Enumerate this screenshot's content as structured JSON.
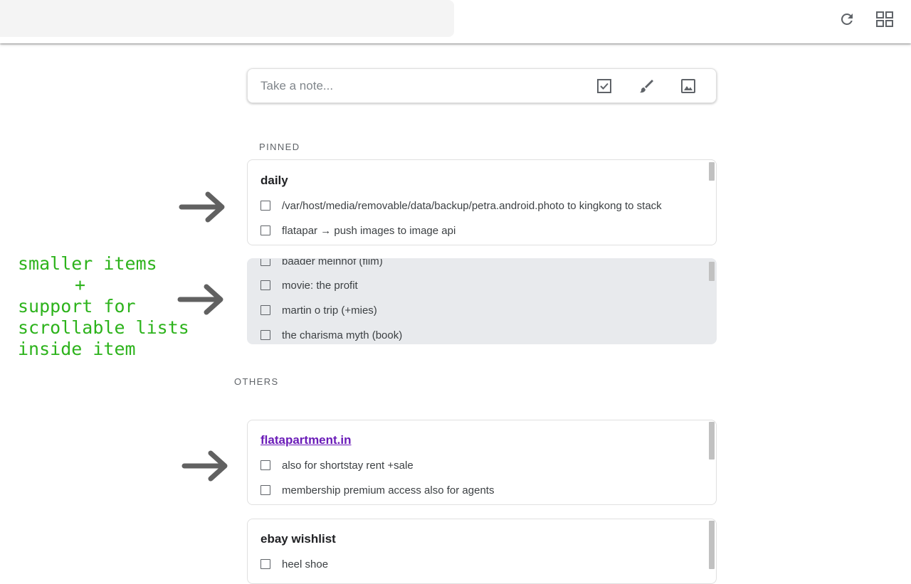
{
  "topbar": {
    "search_placeholder": "",
    "icons": [
      "refresh-icon",
      "grid-view-icon"
    ]
  },
  "take_note": {
    "placeholder": "Take a note...",
    "icons": [
      "checkbox-icon",
      "brush-icon",
      "image-icon"
    ]
  },
  "sections": {
    "pinned": "PINNED",
    "others": "OTHERS"
  },
  "cards": {
    "daily": {
      "title": "daily",
      "items": [
        "/var/host/media/removable/data/backup/petra.android.photo to kingkong to stack",
        "flatapar → push images to image api"
      ]
    },
    "scroll_list": {
      "items": [
        "baader meinhof (film)",
        "movie: the profit",
        "martin o trip (+mies)",
        "the charisma myth (book)"
      ]
    },
    "flatapartment": {
      "title": "flatapartment.in",
      "items": [
        "also for shortstay rent +sale",
        "membership premium access also for agents"
      ]
    },
    "ebay": {
      "title": "ebay wishlist",
      "items": [
        "heel shoe"
      ]
    }
  },
  "annotation": {
    "lines": [
      "smaller items",
      "+",
      "support for",
      "scrollable lists",
      "inside item"
    ],
    "color": "#2db31c"
  }
}
